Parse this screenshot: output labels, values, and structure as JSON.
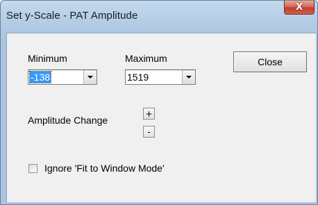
{
  "window": {
    "title": "Set y-Scale - PAT Amplitude",
    "close_glyph": "X"
  },
  "minimum": {
    "label": "Minimum",
    "value": "-138"
  },
  "maximum": {
    "label": "Maximum",
    "value": "1519"
  },
  "close_button": {
    "label": "Close"
  },
  "amplitude": {
    "label": "Amplitude Change",
    "increase_label": "+",
    "decrease_label": "-"
  },
  "fit_mode": {
    "label": "Ignore 'Fit to Window Mode'",
    "checked": false
  },
  "icons": {
    "dropdown": "chevron-down-icon",
    "title_close": "close-icon"
  },
  "colors": {
    "selection": "#3399ff",
    "title_close_button": "#c0402e",
    "frame": "#b4cde6"
  }
}
